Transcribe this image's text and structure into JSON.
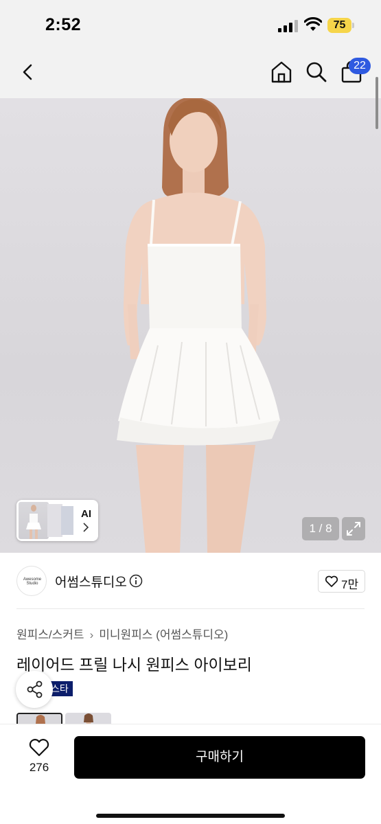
{
  "status_bar": {
    "time": "2:52",
    "battery_level": "75"
  },
  "nav": {
    "cart_count": "22",
    "icons": [
      "back-icon",
      "home-icon",
      "search-icon",
      "shopping-bag-icon"
    ]
  },
  "gallery": {
    "ai_label": "AI",
    "pager": "1 / 8"
  },
  "brand": {
    "logo_text": "Awesome Studio",
    "name": "어썸스튜디오",
    "like_count": "7만"
  },
  "breadcrumb": {
    "category": "원피스/스커트",
    "subcategory": "미니원피스 (어썸스튜디오)"
  },
  "product": {
    "title": "레이어드 프릴 나시 원피스 아이보리",
    "badge": "스타"
  },
  "bottom_bar": {
    "wish_count": "276",
    "buy_label": "구매하기"
  },
  "colors": {
    "battery": "#f6d54a",
    "badge_blue": "#2f5ae0",
    "tag_navy": "#0c1e6b",
    "buy_button": "#000000"
  }
}
